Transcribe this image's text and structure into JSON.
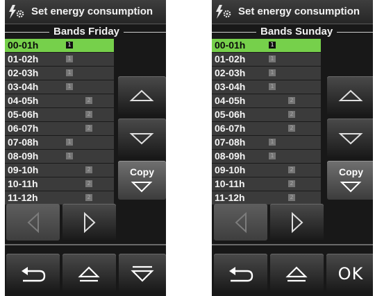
{
  "left_screen": {
    "title": "Set energy consumption",
    "section_label": "Bands Friday",
    "bands": [
      {
        "label": "00-01h",
        "level": "1",
        "selected": true
      },
      {
        "label": "01-02h",
        "level": "1",
        "selected": false
      },
      {
        "label": "02-03h",
        "level": "1",
        "selected": false
      },
      {
        "label": "03-04h",
        "level": "1",
        "selected": false
      },
      {
        "label": "04-05h",
        "level": "2",
        "selected": false
      },
      {
        "label": "05-06h",
        "level": "2",
        "selected": false
      },
      {
        "label": "06-07h",
        "level": "2",
        "selected": false
      },
      {
        "label": "07-08h",
        "level": "1",
        "selected": false
      },
      {
        "label": "08-09h",
        "level": "1",
        "selected": false
      },
      {
        "label": "09-10h",
        "level": "2",
        "selected": false
      },
      {
        "label": "10-11h",
        "level": "2",
        "selected": false
      },
      {
        "label": "11-12h",
        "level": "2",
        "selected": false
      }
    ],
    "copy_label": "Copy",
    "confirm_icon": "eject-icon"
  },
  "right_screen": {
    "title": "Set energy consumption",
    "section_label": "Bands Sunday",
    "bands": [
      {
        "label": "00-01h",
        "level": "1",
        "selected": true
      },
      {
        "label": "01-02h",
        "level": "1",
        "selected": false
      },
      {
        "label": "02-03h",
        "level": "1",
        "selected": false
      },
      {
        "label": "03-04h",
        "level": "1",
        "selected": false
      },
      {
        "label": "04-05h",
        "level": "2",
        "selected": false
      },
      {
        "label": "05-06h",
        "level": "2",
        "selected": false
      },
      {
        "label": "06-07h",
        "level": "2",
        "selected": false
      },
      {
        "label": "07-08h",
        "level": "1",
        "selected": false
      },
      {
        "label": "08-09h",
        "level": "1",
        "selected": false
      },
      {
        "label": "09-10h",
        "level": "2",
        "selected": false
      },
      {
        "label": "10-11h",
        "level": "2",
        "selected": false
      },
      {
        "label": "11-12h",
        "level": "2",
        "selected": false
      }
    ],
    "copy_label": "Copy",
    "ok_label": "OK"
  },
  "colors": {
    "selected_row": "#76d04b",
    "row_bg": "#3b3b3b",
    "screen_bg": "#181818"
  }
}
